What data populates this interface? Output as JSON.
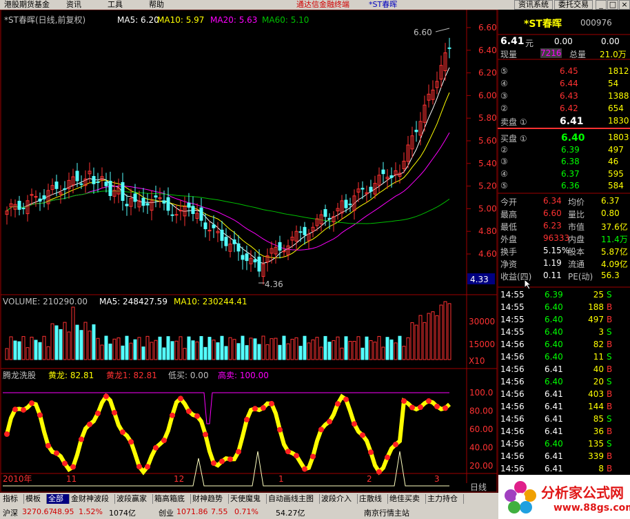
{
  "menu": {
    "items": [
      "港股期货基金",
      "资讯",
      "工具",
      "帮助"
    ],
    "title_left": "通达信金融终端",
    "title_right": "*ST春晖",
    "right_buttons": [
      "资讯系统",
      "委托交易"
    ]
  },
  "kline_header": {
    "name": "*ST春晖(日线,前复权)",
    "ma5_label": "MA5: 6.20",
    "ma10_label": "MA10: 5.97",
    "ma20_label": "MA20: 5.63",
    "ma60_label": "MA60: 5.10"
  },
  "price_axis": [
    "6.60",
    "6.40",
    "6.20",
    "6.00",
    "5.80",
    "5.60",
    "5.40",
    "5.20",
    "5.00",
    "4.80",
    "4.60"
  ],
  "price_highlight": "4.33",
  "high_mark": "6.60",
  "low_mark": "4.36",
  "volume_header": {
    "label": "VOLUME: 210290.00",
    "ma5": "MA5: 248427.59",
    "ma10": "MA10: 230244.41"
  },
  "volume_axis": [
    "30000",
    "15000",
    "X10"
  ],
  "indicator_header": {
    "name": "腾龙洗股",
    "huanglong": "黄龙: 82.81",
    "huanglong1": "黄龙1: 82.81",
    "dimai": "低买: 0.00",
    "gaomai": "高卖: 100.00"
  },
  "indicator_axis": [
    "100.0",
    "80.00",
    "60.00",
    "40.00",
    "20.00"
  ],
  "date_axis": [
    "2010年",
    "11",
    "12",
    "1",
    "2",
    "3"
  ],
  "timeframe": "日线",
  "stock": {
    "name": "*ST春晖",
    "code": "000976",
    "price": "6.41",
    "price_unit": "元",
    "change": "0.00",
    "change_pct": "0.00"
  },
  "volume_info": {
    "xianliang_label": "现量",
    "xianliang": "7216",
    "zongliang_label": "总量",
    "zongliang": "21.0万"
  },
  "sell_orders": [
    {
      "label": "⑤",
      "price": "6.45",
      "vol": "1812"
    },
    {
      "label": "④",
      "price": "6.44",
      "vol": "54"
    },
    {
      "label": "③",
      "price": "6.43",
      "vol": "1388"
    },
    {
      "label": "②",
      "price": "6.42",
      "vol": "654"
    },
    {
      "label": "卖盘 ①",
      "price": "6.41",
      "vol": "1830"
    }
  ],
  "buy_orders": [
    {
      "label": "买盘 ①",
      "price": "6.40",
      "vol": "1803"
    },
    {
      "label": "②",
      "price": "6.39",
      "vol": "497"
    },
    {
      "label": "③",
      "price": "6.38",
      "vol": "46"
    },
    {
      "label": "④",
      "price": "6.37",
      "vol": "595"
    },
    {
      "label": "⑤",
      "price": "6.36",
      "vol": "584"
    }
  ],
  "stats": [
    {
      "l1": "今开",
      "v1": "6.34",
      "l2": "均价",
      "v2": "6.37"
    },
    {
      "l1": "最高",
      "v1": "6.60",
      "l2": "量比",
      "v2": "0.80"
    },
    {
      "l1": "最低",
      "v1": "6.23",
      "l2": "市值",
      "v2": "37.6亿"
    },
    {
      "l1": "外盘",
      "v1": "96333",
      "l2": "内盘",
      "v2": "11.4万"
    },
    {
      "l1": "换手",
      "v1": "5.15%",
      "l2": "股本",
      "v2": "5.87亿"
    },
    {
      "l1": "净资",
      "v1": "1.19",
      "l2": "流通",
      "v2": "4.09亿"
    },
    {
      "l1": "收益(四)",
      "v1": "0.11",
      "l2": "PE(动)",
      "v2": "56.3"
    }
  ],
  "ticks": [
    {
      "t": "14:55",
      "p": "6.39",
      "v": "25",
      "d": "S"
    },
    {
      "t": "14:55",
      "p": "6.40",
      "v": "188",
      "d": "B"
    },
    {
      "t": "14:55",
      "p": "6.40",
      "v": "497",
      "d": "B"
    },
    {
      "t": "14:55",
      "p": "6.40",
      "v": "3",
      "d": "S"
    },
    {
      "t": "14:56",
      "p": "6.40",
      "v": "82",
      "d": "B"
    },
    {
      "t": "14:56",
      "p": "6.40",
      "v": "11",
      "d": "S"
    },
    {
      "t": "14:56",
      "p": "6.41",
      "v": "40",
      "d": "B"
    },
    {
      "t": "14:56",
      "p": "6.40",
      "v": "20",
      "d": "S"
    },
    {
      "t": "14:56",
      "p": "6.41",
      "v": "403",
      "d": "B"
    },
    {
      "t": "14:56",
      "p": "6.41",
      "v": "144",
      "d": "B"
    },
    {
      "t": "14:56",
      "p": "6.41",
      "v": "85",
      "d": "S"
    },
    {
      "t": "14:56",
      "p": "6.41",
      "v": "36",
      "d": "B"
    },
    {
      "t": "14:56",
      "p": "6.40",
      "v": "135",
      "d": "S"
    },
    {
      "t": "14:56",
      "p": "6.41",
      "v": "339",
      "d": "B"
    },
    {
      "t": "14:56",
      "p": "6.41",
      "v": "8",
      "d": "B"
    }
  ],
  "tabs": [
    "指标",
    "模板",
    "全部",
    "金财神波段",
    "波段赢家",
    "箱高箱底",
    "财神趋势",
    "天使魔鬼",
    "自动画线主图",
    "波段介入",
    "庄散线",
    "绝佳买卖",
    "主力持仓"
  ],
  "status": {
    "sh_label": "沪深",
    "sh_index": "3270.67",
    "sh_change": "48.95",
    "sh_pct": "1.52%",
    "sh_amount": "1074亿",
    "sz_label": "创业",
    "sz_index": "1071.86",
    "sz_change": "7.55",
    "sz_pct": "0.71%",
    "sz_amount": "54.27亿",
    "news": "南京行情主站"
  },
  "logo": {
    "text": "分析家公式网",
    "url": "www.88gs.com"
  },
  "colors": {
    "up": "#ff3232",
    "down": "#54ffff",
    "ma5": "#ffffff",
    "ma10": "#ffff00",
    "ma20": "#ff00ff",
    "ma60": "#00c000"
  }
}
